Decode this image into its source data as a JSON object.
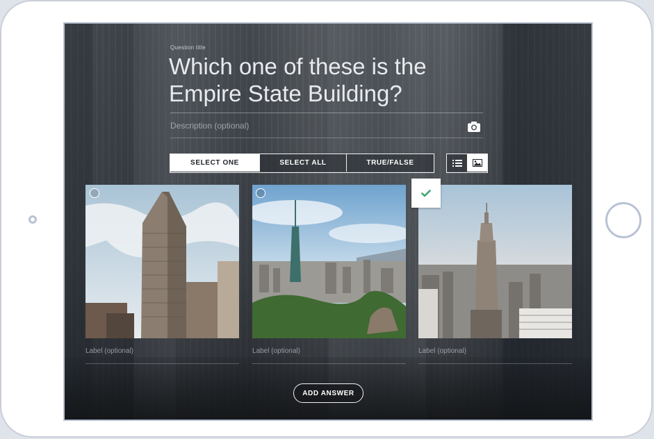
{
  "question": {
    "title_label": "Question title",
    "title": "Which one of these is the Empire State Building?",
    "description_placeholder": "Description (optional)",
    "camera_icon": "camera-icon"
  },
  "modes": [
    {
      "label": "SELECT ONE",
      "active": true
    },
    {
      "label": "SELECT ALL",
      "active": false
    },
    {
      "label": "TRUE/FALSE",
      "active": false
    }
  ],
  "view_toggle": {
    "list_icon": "list-icon",
    "image_icon": "image-icon",
    "selected": "image"
  },
  "answers": [
    {
      "image": "Flatiron Building photo",
      "label_placeholder": "Label (optional)",
      "correct": false
    },
    {
      "image": "Taipei 101 photo",
      "label_placeholder": "Label (optional)",
      "correct": false
    },
    {
      "image": "Empire State Building photo",
      "label_placeholder": "Label (optional)",
      "correct": true
    }
  ],
  "add_answer_label": "ADD ANSWER",
  "colors": {
    "accent_check": "#3aa76d",
    "text": "#e9eaed"
  }
}
